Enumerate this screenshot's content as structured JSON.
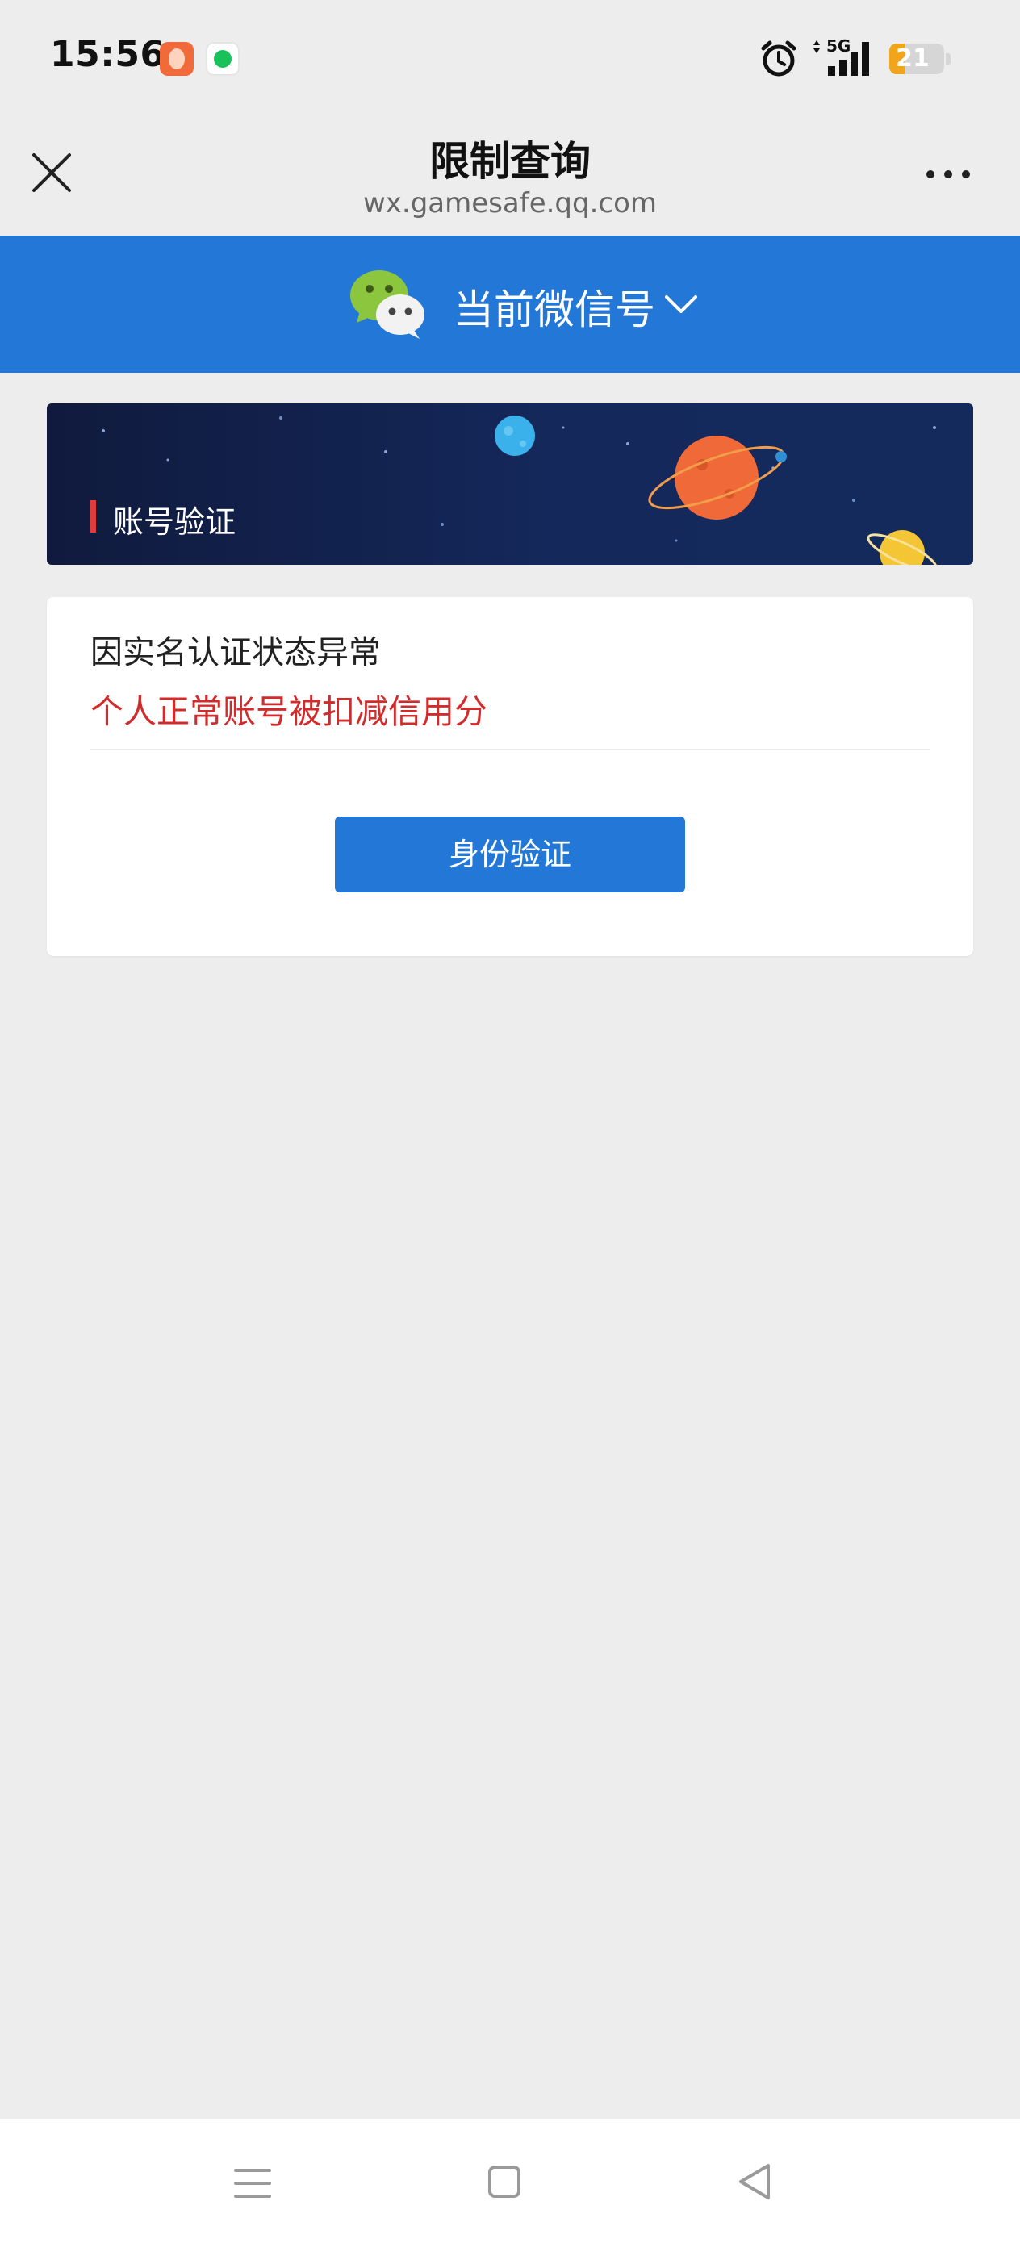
{
  "status_bar": {
    "time": "15:56",
    "network": "5G",
    "battery": "21",
    "battery_level": 0.21
  },
  "title_bar": {
    "title": "限制查询",
    "url": "wx.gamesafe.qq.com",
    "close_icon": "close-icon",
    "more_icon": "more-icon"
  },
  "account": {
    "name": "当前微信号",
    "icon": "wechat-logo-icon"
  },
  "banner": {
    "title": "账号验证"
  },
  "result": {
    "reason": "因实名认证状态异常",
    "penalty": "个人正常账号被扣减信用分",
    "penalty_color": "#d22b2b",
    "verify_button": "身份验证"
  },
  "colors": {
    "accent": "#2378d7",
    "background": "#ededed"
  },
  "nav": {
    "icons": [
      "menu-icon",
      "home-icon",
      "back-icon"
    ]
  }
}
